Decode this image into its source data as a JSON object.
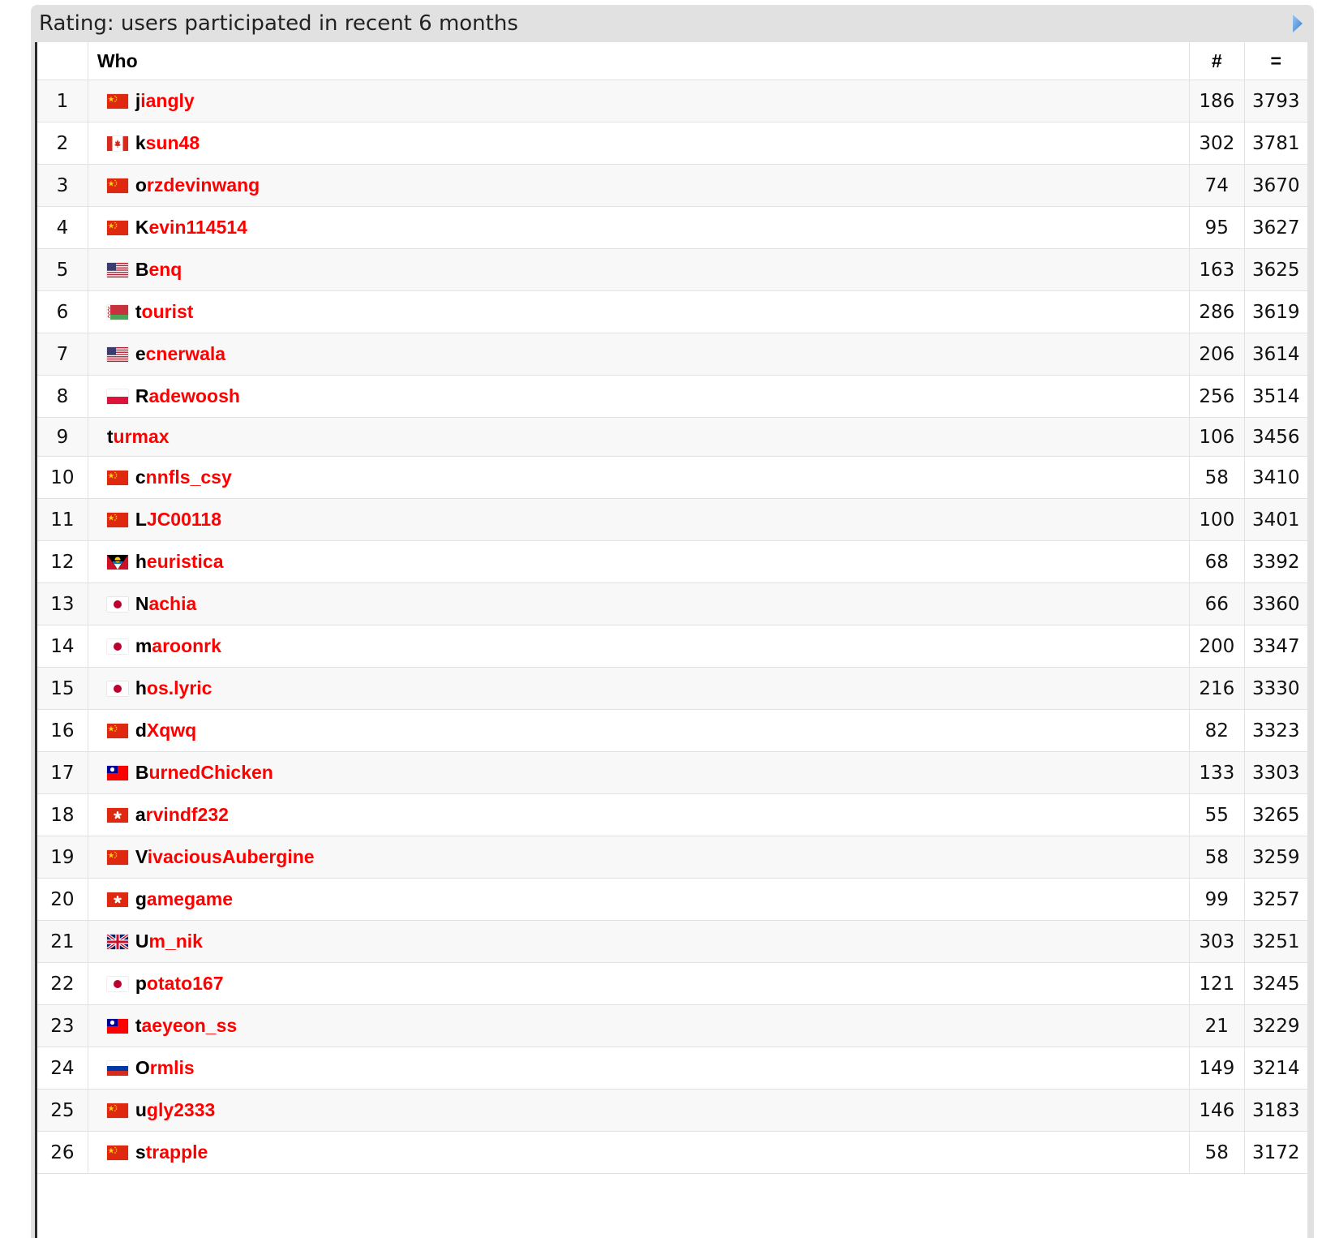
{
  "panel": {
    "title": "Rating: users participated in recent 6 months",
    "toggle_icon": "triangle-right-icon"
  },
  "table": {
    "headers": {
      "rank": "",
      "who": "Who",
      "contests": "#",
      "rating": "="
    },
    "rows": [
      {
        "rank": "1",
        "flag": "cn",
        "handle": "jiangly",
        "contests": "186",
        "rating": "3793"
      },
      {
        "rank": "2",
        "flag": "ca",
        "handle": "ksun48",
        "contests": "302",
        "rating": "3781"
      },
      {
        "rank": "3",
        "flag": "cn",
        "handle": "orzdevinwang",
        "contests": "74",
        "rating": "3670"
      },
      {
        "rank": "4",
        "flag": "cn",
        "handle": "Kevin114514",
        "contests": "95",
        "rating": "3627"
      },
      {
        "rank": "5",
        "flag": "us",
        "handle": "Benq",
        "contests": "163",
        "rating": "3625"
      },
      {
        "rank": "6",
        "flag": "by",
        "handle": "tourist",
        "contests": "286",
        "rating": "3619"
      },
      {
        "rank": "7",
        "flag": "us",
        "handle": "ecnerwala",
        "contests": "206",
        "rating": "3614"
      },
      {
        "rank": "8",
        "flag": "pl",
        "handle": "Radewoosh",
        "contests": "256",
        "rating": "3514"
      },
      {
        "rank": "9",
        "flag": "",
        "handle": "turmax",
        "contests": "106",
        "rating": "3456"
      },
      {
        "rank": "10",
        "flag": "cn",
        "handle": "cnnfls_csy",
        "contests": "58",
        "rating": "3410"
      },
      {
        "rank": "11",
        "flag": "cn",
        "handle": "LJC00118",
        "contests": "100",
        "rating": "3401"
      },
      {
        "rank": "12",
        "flag": "ag",
        "handle": "heuristica",
        "contests": "68",
        "rating": "3392"
      },
      {
        "rank": "13",
        "flag": "jp",
        "handle": "Nachia",
        "contests": "66",
        "rating": "3360"
      },
      {
        "rank": "14",
        "flag": "jp",
        "handle": "maroonrk",
        "contests": "200",
        "rating": "3347"
      },
      {
        "rank": "15",
        "flag": "jp",
        "handle": "hos.lyric",
        "contests": "216",
        "rating": "3330"
      },
      {
        "rank": "16",
        "flag": "cn",
        "handle": "dXqwq",
        "contests": "82",
        "rating": "3323"
      },
      {
        "rank": "17",
        "flag": "tw",
        "handle": "BurnedChicken",
        "contests": "133",
        "rating": "3303"
      },
      {
        "rank": "18",
        "flag": "hk",
        "handle": "arvindf232",
        "contests": "55",
        "rating": "3265"
      },
      {
        "rank": "19",
        "flag": "cn",
        "handle": "VivaciousAubergine",
        "contests": "58",
        "rating": "3259"
      },
      {
        "rank": "20",
        "flag": "hk",
        "handle": "gamegame",
        "contests": "99",
        "rating": "3257"
      },
      {
        "rank": "21",
        "flag": "gb",
        "handle": "Um_nik",
        "contests": "303",
        "rating": "3251"
      },
      {
        "rank": "22",
        "flag": "jp",
        "handle": "potato167",
        "contests": "121",
        "rating": "3245"
      },
      {
        "rank": "23",
        "flag": "tw",
        "handle": "taeyeon_ss",
        "contests": "21",
        "rating": "3229"
      },
      {
        "rank": "24",
        "flag": "ru",
        "handle": "Ormlis",
        "contests": "149",
        "rating": "3214"
      },
      {
        "rank": "25",
        "flag": "cn",
        "handle": "ugly2333",
        "contests": "146",
        "rating": "3183"
      },
      {
        "rank": "26",
        "flag": "cn",
        "handle": "strapple",
        "contests": "58",
        "rating": "3172"
      }
    ]
  },
  "colors": {
    "handle_first_letter": "#000000",
    "handle_rest": "#ff0000",
    "header_bar": "#e1e1e1",
    "toggle_icon": "#3b8fd9"
  }
}
